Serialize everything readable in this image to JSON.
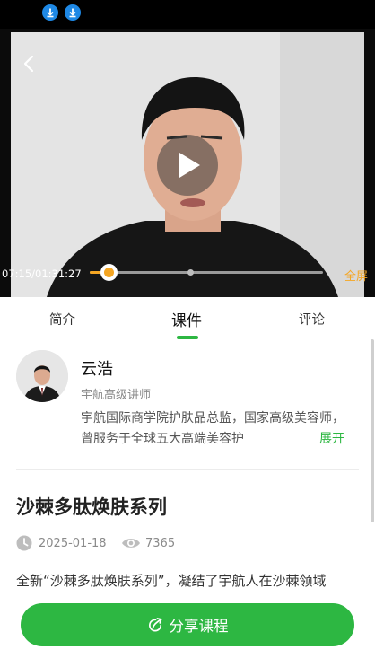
{
  "status_bar": {
    "icons": [
      "download-icon",
      "download-icon"
    ]
  },
  "player": {
    "time": "07:15/01:31:27",
    "progress_fraction": 0.079,
    "fullscreen_label": "全屏",
    "accent_color": "#f5a623"
  },
  "tabs": [
    {
      "label": "简介",
      "active": false
    },
    {
      "label": "课件",
      "active": true
    },
    {
      "label": "评论",
      "active": false
    }
  ],
  "teacher": {
    "name": "云浩",
    "title": "宇航高级讲师",
    "bio": "宇航国际商学院护肤品总监，国家高级美容师，曾服务于全球五大高端美容护",
    "expand_label": "展开"
  },
  "course": {
    "title": "沙棘多肽焕肤系列",
    "date": "2025-01-18",
    "views": "7365",
    "description": "全新“沙棘多肽焕肤系列”，凝结了宇航人在沙棘领域"
  },
  "share": {
    "label": "分享课程",
    "color": "#2db742"
  }
}
